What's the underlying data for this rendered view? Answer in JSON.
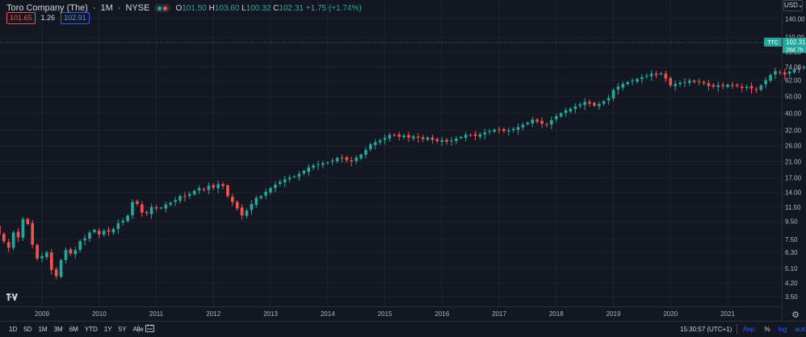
{
  "legend": {
    "title": "Toro Company (The)",
    "interval": "1M",
    "exchange": "NYSE",
    "open_label": "O",
    "open": "101.50",
    "high_label": "H",
    "high": "103.60",
    "low_label": "L",
    "low": "100.32",
    "close_label": "C",
    "close": "102.31",
    "change": "+1.75 (+1.74%)"
  },
  "prices": {
    "bid": "101.65",
    "spread": "1.26",
    "ask": "102.91"
  },
  "currency": "USD",
  "last_price_label": {
    "ticker": "TTC",
    "price": "102.31",
    "countdown": "28d 7h"
  },
  "bottom_bar": {
    "timeframes": [
      "1D",
      "5D",
      "1M",
      "3M",
      "6M",
      "YTD",
      "1Y",
      "5Y",
      "Alle"
    ],
    "clock": "15:30:57 (UTC+1)",
    "options": [
      "Anp.",
      "%",
      "log",
      "auto"
    ]
  },
  "colors": {
    "up": "#26a69a",
    "down": "#ef5350",
    "background": "#131722",
    "grid": "#1e222d",
    "text": "#d1d4dc",
    "accent": "#2962ff"
  },
  "icons": [
    "tradingview-logo-icon",
    "calendar-range-icon",
    "settings-gear-icon"
  ],
  "chart_data": {
    "type": "candlestick",
    "interval": "monthly",
    "scale": "log",
    "y_ticks": [
      3.5,
      4.2,
      5.1,
      6.3,
      7.5,
      9.5,
      11.5,
      14.0,
      17.0,
      21.0,
      26.0,
      32.0,
      40.0,
      50.0,
      62.0,
      74.0,
      90.0,
      110.0,
      140.0
    ],
    "y_tick_labels": [
      "3.50",
      "4.20",
      "5.10",
      "6.30",
      "7.50",
      "9.50",
      "11.50",
      "14.00",
      "17.00",
      "21.00",
      "26.00",
      "32.00",
      "40.00",
      "50.00",
      "62.00",
      "74.00",
      "90.00",
      "110.00",
      "140.00"
    ],
    "x_tick_labels": [
      "2009",
      "2010",
      "2011",
      "2012",
      "2013",
      "2014",
      "2015",
      "2016",
      "2017",
      "2018",
      "2019",
      "2020",
      "2021"
    ],
    "ylim": [
      3.0,
      160.0
    ],
    "grid": true,
    "start": "2008-03",
    "closes": [
      9.0,
      8.0,
      7.3,
      6.7,
      8.2,
      7.7,
      9.8,
      9.2,
      7.0,
      5.8,
      6.0,
      6.3,
      5.0,
      4.6,
      5.7,
      6.5,
      6.2,
      6.5,
      7.3,
      7.6,
      8.2,
      8.5,
      8.0,
      8.4,
      8.3,
      8.6,
      9.3,
      9.6,
      10.3,
      12.3,
      12.0,
      10.7,
      10.6,
      11.5,
      11.3,
      11.4,
      11.9,
      12.2,
      12.6,
      13.3,
      13.2,
      13.7,
      14.3,
      14.8,
      14.5,
      15.3,
      14.9,
      15.6,
      15.2,
      13.3,
      12.3,
      11.3,
      10.3,
      11.0,
      12.0,
      13.0,
      13.3,
      14.1,
      14.8,
      15.5,
      16.1,
      16.6,
      17.0,
      17.3,
      17.9,
      18.6,
      19.5,
      20.0,
      20.3,
      20.6,
      20.8,
      21.3,
      22.1,
      22.0,
      21.5,
      21.1,
      22.2,
      23.1,
      24.6,
      26.5,
      27.2,
      27.9,
      28.8,
      30.0,
      29.8,
      29.3,
      29.8,
      29.0,
      29.4,
      28.9,
      28.4,
      29.0,
      28.1,
      27.6,
      28.0,
      27.4,
      27.8,
      28.6,
      29.2,
      30.1,
      30.0,
      29.6,
      30.2,
      31.0,
      31.6,
      32.2,
      32.0,
      31.6,
      31.8,
      32.5,
      33.3,
      34.3,
      35.3,
      36.8,
      35.8,
      34.8,
      34.4,
      36.5,
      38.5,
      40.0,
      41.5,
      42.5,
      43.8,
      45.0,
      46.5,
      45.5,
      44.3,
      45.3,
      46.8,
      49.0,
      54.5,
      57.0,
      59.0,
      60.5,
      61.5,
      63.0,
      64.5,
      66.0,
      67.5,
      66.5,
      68.0,
      63.5,
      58.0,
      59.0,
      60.0,
      60.5,
      61.5,
      60.5,
      61.0,
      59.5,
      57.5,
      57.0,
      58.0,
      57.5,
      58.5,
      58.0,
      57.5,
      56.0,
      56.8,
      55.5,
      54.5,
      58.0,
      62.0,
      66.5,
      70.0,
      69.0,
      67.0,
      69.5,
      71.5,
      72.5,
      74.0,
      76.0,
      77.5,
      74.5,
      76.0,
      77.5,
      80.0,
      79.0,
      64.0,
      59.0,
      57.5,
      63.0,
      66.5,
      70.0,
      72.0,
      76.0,
      80.0,
      84.0,
      90.0,
      94.0,
      95.0,
      97.0,
      100.0,
      105.0,
      111.0,
      118.0,
      117.0,
      115.0,
      113.0,
      116.0,
      118.0,
      110.0,
      104.0,
      100.56,
      102.31
    ]
  }
}
